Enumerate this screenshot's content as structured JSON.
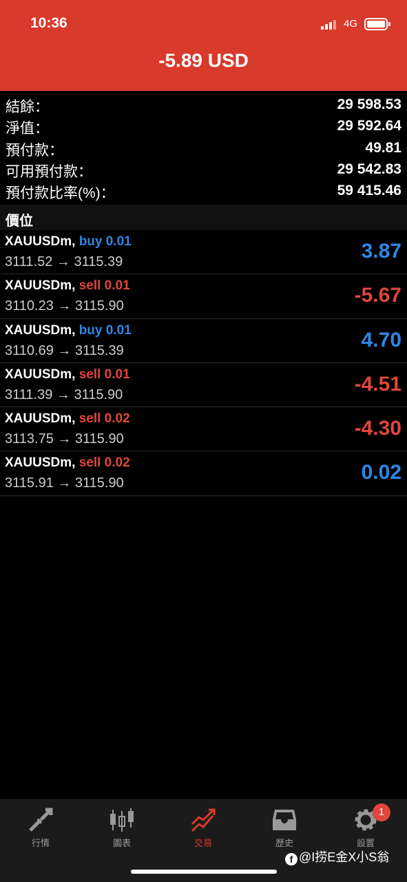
{
  "status_bar": {
    "time": "10:36",
    "network": "4G",
    "battery_level": 1.0
  },
  "header": {
    "title": "-5.89 USD",
    "background_color": "#d83a2c"
  },
  "summary": [
    {
      "label": "結餘：",
      "value": "29 598.53"
    },
    {
      "label": "淨值：",
      "value": "29 592.64"
    },
    {
      "label": "預付款：",
      "value": "49.81"
    },
    {
      "label": "可用預付款：",
      "value": "29 542.83"
    },
    {
      "label": "預付款比率(%)：",
      "value": "59 415.46"
    }
  ],
  "positions_section": {
    "title": "價位"
  },
  "positions": [
    {
      "symbol": "XAUUSDm,",
      "side": "buy 0.01",
      "prices": "3111.52 → 3115.39",
      "profit": "3.87",
      "color": "#2f86e6"
    },
    {
      "symbol": "XAUUSDm,",
      "side": "sell 0.01",
      "prices": "3110.23 → 3115.90",
      "profit": "-5.67",
      "color": "#e0463c"
    },
    {
      "symbol": "XAUUSDm,",
      "side": "buy 0.01",
      "prices": "3110.69 → 3115.39",
      "profit": "4.70",
      "color": "#2f86e6"
    },
    {
      "symbol": "XAUUSDm,",
      "side": "sell 0.01",
      "prices": "3111.39 → 3115.90",
      "profit": "-4.51",
      "color": "#e0463c"
    },
    {
      "symbol": "XAUUSDm,",
      "side": "sell 0.02",
      "prices": "3113.75 → 3115.90",
      "profit": "-4.30",
      "color": "#e0463c"
    },
    {
      "symbol": "XAUUSDm,",
      "side": "sell 0.02",
      "prices": "3115.91 → 3115.90",
      "profit": "0.02",
      "color": "#2f86e6"
    }
  ],
  "tabs": [
    {
      "label": "行情",
      "icon": "quotes-arrows-icon"
    },
    {
      "label": "圖表",
      "icon": "candlestick-chart-icon"
    },
    {
      "label": "交易",
      "icon": "trade-trend-icon",
      "active": true
    },
    {
      "label": "歷史",
      "icon": "history-tray-icon"
    },
    {
      "label": "設置",
      "icon": "gear-icon"
    }
  ],
  "settings_badge": "1",
  "watermark": "@I捞E金X小S翁",
  "colors": {
    "accent": "#d83a2c",
    "buy": "#2f86e6",
    "sell": "#e0463c"
  }
}
